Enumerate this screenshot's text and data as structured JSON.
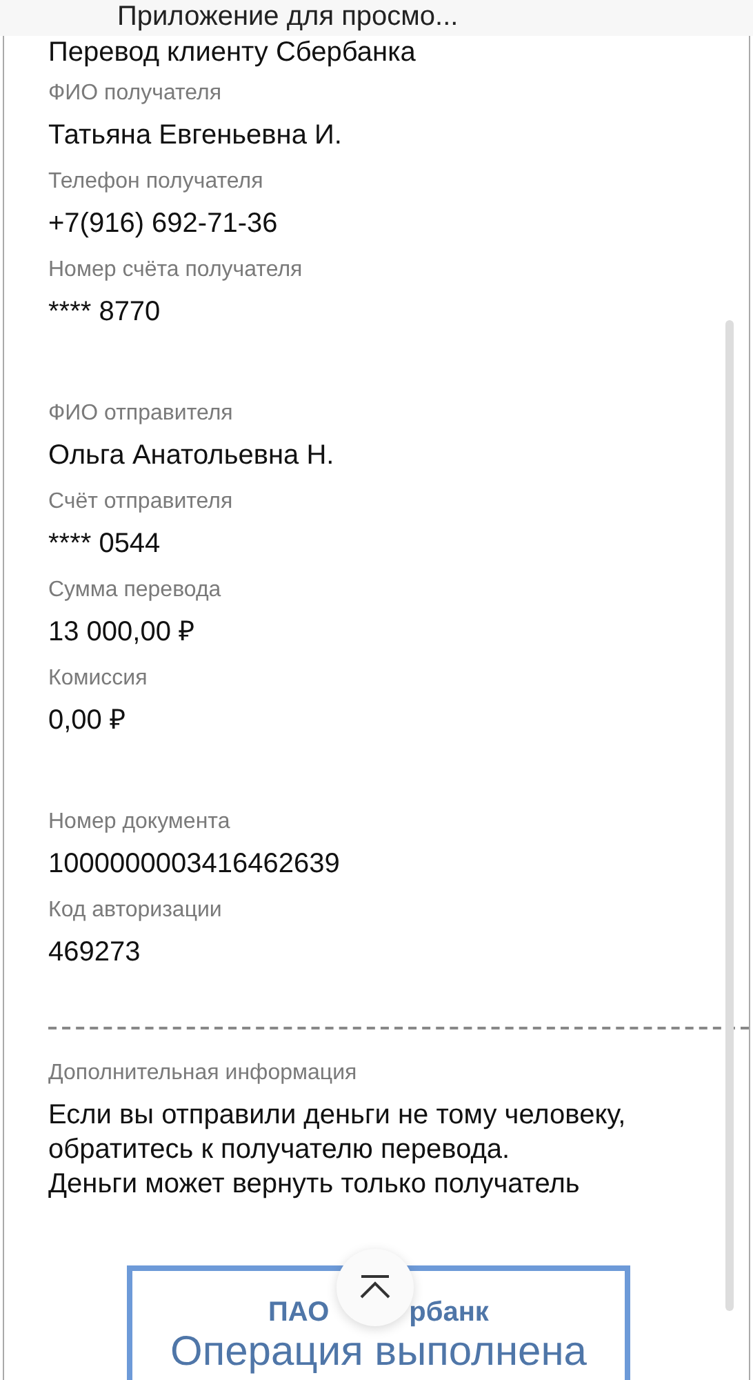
{
  "top_bar": {
    "title": "Приложение для просмо..."
  },
  "heading": "Перевод клиенту Сбербанка",
  "groups": [
    {
      "fields": [
        {
          "label": "ФИО получателя",
          "value": "Татьяна Евгеньевна И."
        },
        {
          "label": "Телефон получателя",
          "value": "+7(916) 692-71-36"
        },
        {
          "label": "Номер счёта получателя",
          "value": "**** 8770"
        }
      ]
    },
    {
      "fields": [
        {
          "label": "ФИО отправителя",
          "value": "Ольга Анатольевна Н."
        },
        {
          "label": "Счёт отправителя",
          "value": "**** 0544"
        },
        {
          "label": "Сумма перевода",
          "value": "13 000,00 ₽"
        },
        {
          "label": "Комиссия",
          "value": "0,00 ₽"
        }
      ]
    },
    {
      "fields": [
        {
          "label": "Номер документа",
          "value": "1000000003416462639"
        },
        {
          "label": "Код авторизации",
          "value": "469273"
        }
      ]
    }
  ],
  "additional_info": {
    "label": "Дополнительная информация",
    "lines": [
      "Если вы отправили деньги не тому человеку,",
      "обратитесь к получателю перевода.",
      "Деньги может вернуть только получатель"
    ]
  },
  "stamp": {
    "bank_parts": [
      "ПАО",
      "рбанк"
    ],
    "status": "Операция выполнена"
  }
}
